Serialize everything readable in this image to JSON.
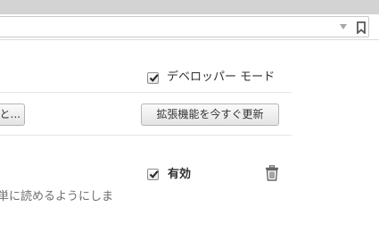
{
  "browser": {
    "url_text": "",
    "dropdown_icon": "triangle-down-icon",
    "bookmark_icon": "bookmark-icon"
  },
  "developer_mode": {
    "label": "デベロッパー モード",
    "checked": true
  },
  "buttons": {
    "partial_button_label": "と...",
    "update_extensions_label": "拡張機能を今すぐ更新"
  },
  "extension": {
    "enabled_label": "有効",
    "enabled_checked": true,
    "remove_icon": "trash-icon",
    "description": "単に読めるようにしま"
  },
  "colors": {
    "topbar": "#d3d3d3",
    "text": "#303030",
    "muted_text": "#6e6e6e"
  }
}
